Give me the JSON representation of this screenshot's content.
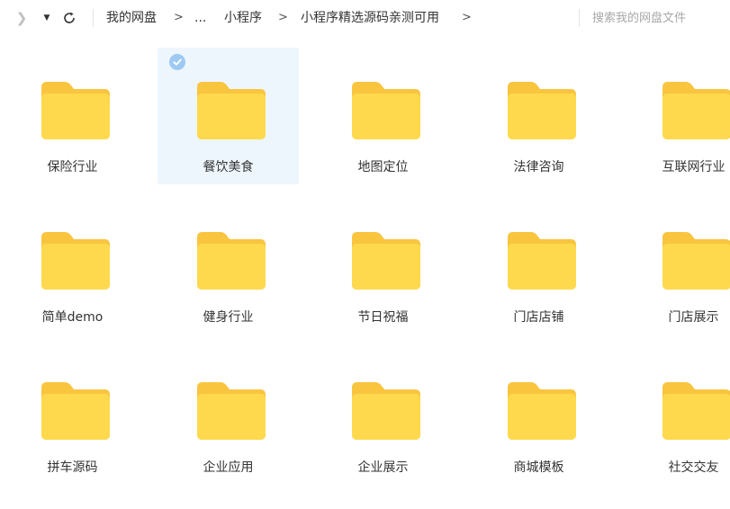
{
  "toolbar": {
    "forward_icon": "chevron-right-icon",
    "dropdown_icon": "triangle-down-icon",
    "refresh_icon": "refresh-icon",
    "breadcrumb": [
      "我的网盘",
      "...",
      "小程序",
      "小程序精选源码亲测可用"
    ],
    "breadcrumb_separator": ">",
    "search_placeholder": "搜索我的网盘文件"
  },
  "folders": [
    {
      "name": "保险行业",
      "selected": false
    },
    {
      "name": "餐饮美食",
      "selected": true
    },
    {
      "name": "地图定位",
      "selected": false
    },
    {
      "name": "法律咨询",
      "selected": false
    },
    {
      "name": "互联网行业",
      "selected": false
    },
    {
      "name": "简单demo",
      "selected": false
    },
    {
      "name": "健身行业",
      "selected": false
    },
    {
      "name": "节日祝福",
      "selected": false
    },
    {
      "name": "门店店铺",
      "selected": false
    },
    {
      "name": "门店展示",
      "selected": false
    },
    {
      "name": "拼车源码",
      "selected": false
    },
    {
      "name": "企业应用",
      "selected": false
    },
    {
      "name": "企业展示",
      "selected": false
    },
    {
      "name": "商城模板",
      "selected": false
    },
    {
      "name": "社交交友",
      "selected": false
    }
  ],
  "colors": {
    "folder_back": "#f9c53f",
    "folder_front": "#ffd94d",
    "selected_bg": "#eef6fd",
    "check_badge": "#9dc9f3"
  }
}
